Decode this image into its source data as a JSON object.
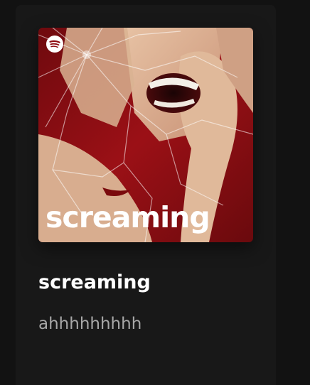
{
  "card": {
    "cover": {
      "overlay_text": "screaming",
      "logo_icon": "spotify-logo-icon",
      "image": "screaming-face-shattered-glass-red"
    },
    "title": "screaming",
    "subtitle": "ahhhhhhhhh"
  },
  "colors": {
    "background": "#121212",
    "card_background": "#181818",
    "title": "#ffffff",
    "subtitle": "#a7a7a7",
    "cover_red": "#8e0d12"
  }
}
